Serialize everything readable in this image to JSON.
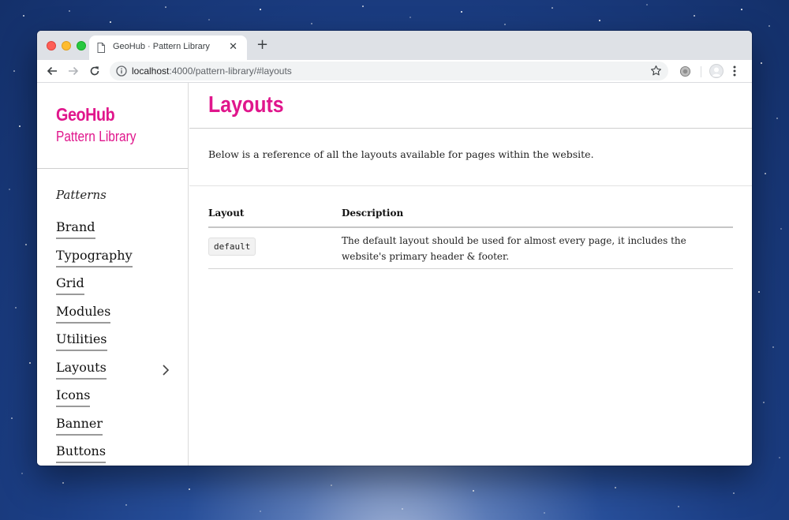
{
  "browser": {
    "tab_title": "GeoHub · Pattern Library",
    "url_host": "localhost",
    "url_path": ":4000/pattern-library/#layouts"
  },
  "sidebar": {
    "site_name": "GeoHub",
    "site_subtitle": "Pattern Library",
    "section_label": "Patterns",
    "items": [
      {
        "label": "Brand"
      },
      {
        "label": "Typography"
      },
      {
        "label": "Grid"
      },
      {
        "label": "Modules"
      },
      {
        "label": "Utilities"
      },
      {
        "label": "Layouts",
        "expandable": true
      },
      {
        "label": "Icons"
      },
      {
        "label": "Banner"
      },
      {
        "label": "Buttons"
      }
    ]
  },
  "main": {
    "title": "Layouts",
    "intro": "Below is a reference of all the layouts available for pages within the website.",
    "table": {
      "headers": [
        "Layout",
        "Description"
      ],
      "rows": [
        {
          "layout": "default",
          "description": "The default layout should be used for almost every page, it includes the website's primary header & footer."
        }
      ]
    }
  },
  "colors": {
    "accent": "#e0168c",
    "desktop_bg": "#1c3f86"
  },
  "icons": [
    "page-icon",
    "close-icon",
    "plus-icon",
    "back-arrow-icon",
    "forward-arrow-icon",
    "reload-icon",
    "info-icon",
    "star-icon",
    "extension-icon",
    "profile-icon",
    "menu-dots-icon",
    "chevron-right-icon"
  ]
}
